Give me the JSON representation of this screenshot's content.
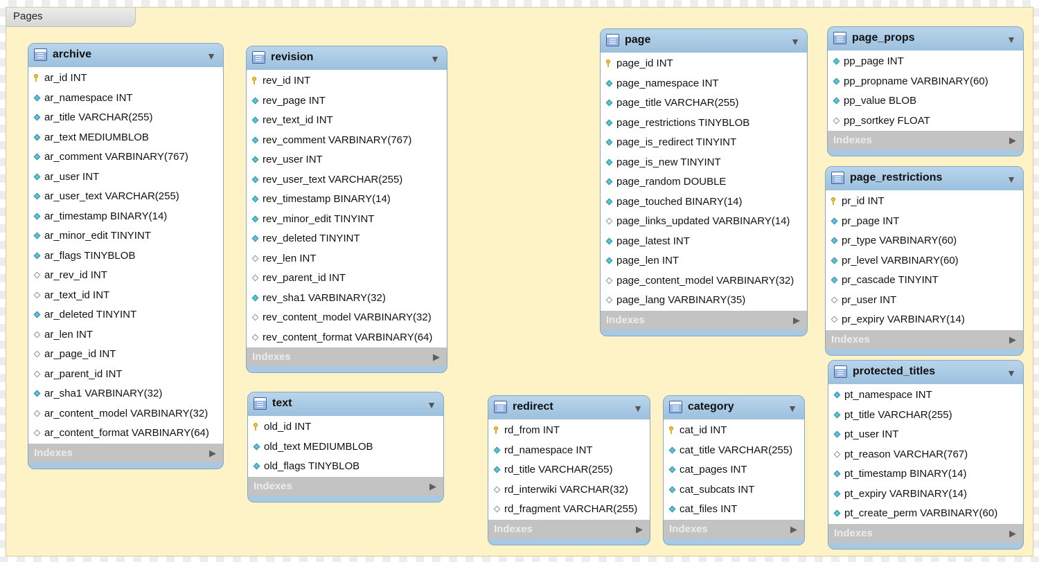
{
  "layer": {
    "title": "Pages"
  },
  "indexes_label": "Indexes",
  "tables": [
    {
      "name": "archive",
      "columns": [
        {
          "text": "ar_id INT",
          "icon": "key"
        },
        {
          "text": "ar_namespace INT",
          "icon": "filled"
        },
        {
          "text": "ar_title VARCHAR(255)",
          "icon": "filled"
        },
        {
          "text": "ar_text MEDIUMBLOB",
          "icon": "filled"
        },
        {
          "text": "ar_comment VARBINARY(767)",
          "icon": "filled"
        },
        {
          "text": "ar_user INT",
          "icon": "filled"
        },
        {
          "text": "ar_user_text VARCHAR(255)",
          "icon": "filled"
        },
        {
          "text": "ar_timestamp BINARY(14)",
          "icon": "filled"
        },
        {
          "text": "ar_minor_edit TINYINT",
          "icon": "filled"
        },
        {
          "text": "ar_flags TINYBLOB",
          "icon": "filled"
        },
        {
          "text": "ar_rev_id INT",
          "icon": "empty"
        },
        {
          "text": "ar_text_id INT",
          "icon": "empty"
        },
        {
          "text": "ar_deleted TINYINT",
          "icon": "filled"
        },
        {
          "text": "ar_len INT",
          "icon": "empty"
        },
        {
          "text": "ar_page_id INT",
          "icon": "empty"
        },
        {
          "text": "ar_parent_id INT",
          "icon": "empty"
        },
        {
          "text": "ar_sha1 VARBINARY(32)",
          "icon": "filled"
        },
        {
          "text": "ar_content_model VARBINARY(32)",
          "icon": "empty"
        },
        {
          "text": "ar_content_format VARBINARY(64)",
          "icon": "empty"
        }
      ]
    },
    {
      "name": "revision",
      "columns": [
        {
          "text": "rev_id INT",
          "icon": "key"
        },
        {
          "text": "rev_page INT",
          "icon": "filled"
        },
        {
          "text": "rev_text_id INT",
          "icon": "filled"
        },
        {
          "text": "rev_comment VARBINARY(767)",
          "icon": "filled"
        },
        {
          "text": "rev_user INT",
          "icon": "filled"
        },
        {
          "text": "rev_user_text VARCHAR(255)",
          "icon": "filled"
        },
        {
          "text": "rev_timestamp BINARY(14)",
          "icon": "filled"
        },
        {
          "text": "rev_minor_edit TINYINT",
          "icon": "filled"
        },
        {
          "text": "rev_deleted TINYINT",
          "icon": "filled"
        },
        {
          "text": "rev_len INT",
          "icon": "empty"
        },
        {
          "text": "rev_parent_id INT",
          "icon": "empty"
        },
        {
          "text": "rev_sha1 VARBINARY(32)",
          "icon": "filled"
        },
        {
          "text": "rev_content_model VARBINARY(32)",
          "icon": "empty"
        },
        {
          "text": "rev_content_format VARBINARY(64)",
          "icon": "empty"
        }
      ]
    },
    {
      "name": "text",
      "columns": [
        {
          "text": "old_id INT",
          "icon": "key"
        },
        {
          "text": "old_text MEDIUMBLOB",
          "icon": "filled"
        },
        {
          "text": "old_flags TINYBLOB",
          "icon": "filled"
        }
      ]
    },
    {
      "name": "page",
      "columns": [
        {
          "text": "page_id INT",
          "icon": "key"
        },
        {
          "text": "page_namespace INT",
          "icon": "filled"
        },
        {
          "text": "page_title VARCHAR(255)",
          "icon": "filled"
        },
        {
          "text": "page_restrictions TINYBLOB",
          "icon": "filled"
        },
        {
          "text": "page_is_redirect TINYINT",
          "icon": "filled"
        },
        {
          "text": "page_is_new TINYINT",
          "icon": "filled"
        },
        {
          "text": "page_random DOUBLE",
          "icon": "filled"
        },
        {
          "text": "page_touched BINARY(14)",
          "icon": "filled"
        },
        {
          "text": "page_links_updated VARBINARY(14)",
          "icon": "empty"
        },
        {
          "text": "page_latest INT",
          "icon": "filled"
        },
        {
          "text": "page_len INT",
          "icon": "filled"
        },
        {
          "text": "page_content_model VARBINARY(32)",
          "icon": "empty"
        },
        {
          "text": "page_lang VARBINARY(35)",
          "icon": "empty"
        }
      ]
    },
    {
      "name": "page_props",
      "columns": [
        {
          "text": "pp_page INT",
          "icon": "filled"
        },
        {
          "text": "pp_propname VARBINARY(60)",
          "icon": "filled"
        },
        {
          "text": "pp_value BLOB",
          "icon": "filled"
        },
        {
          "text": "pp_sortkey FLOAT",
          "icon": "empty"
        }
      ]
    },
    {
      "name": "page_restrictions",
      "columns": [
        {
          "text": "pr_id INT",
          "icon": "key"
        },
        {
          "text": "pr_page INT",
          "icon": "filled"
        },
        {
          "text": "pr_type VARBINARY(60)",
          "icon": "filled"
        },
        {
          "text": "pr_level VARBINARY(60)",
          "icon": "filled"
        },
        {
          "text": "pr_cascade TINYINT",
          "icon": "filled"
        },
        {
          "text": "pr_user INT",
          "icon": "empty"
        },
        {
          "text": "pr_expiry VARBINARY(14)",
          "icon": "empty"
        }
      ]
    },
    {
      "name": "protected_titles",
      "columns": [
        {
          "text": "pt_namespace INT",
          "icon": "filled"
        },
        {
          "text": "pt_title VARCHAR(255)",
          "icon": "filled"
        },
        {
          "text": "pt_user INT",
          "icon": "filled"
        },
        {
          "text": "pt_reason VARCHAR(767)",
          "icon": "empty"
        },
        {
          "text": "pt_timestamp BINARY(14)",
          "icon": "filled"
        },
        {
          "text": "pt_expiry VARBINARY(14)",
          "icon": "filled"
        },
        {
          "text": "pt_create_perm VARBINARY(60)",
          "icon": "filled"
        }
      ]
    },
    {
      "name": "redirect",
      "columns": [
        {
          "text": "rd_from INT",
          "icon": "key"
        },
        {
          "text": "rd_namespace INT",
          "icon": "filled"
        },
        {
          "text": "rd_title VARCHAR(255)",
          "icon": "filled"
        },
        {
          "text": "rd_interwiki VARCHAR(32)",
          "icon": "empty"
        },
        {
          "text": "rd_fragment VARCHAR(255)",
          "icon": "empty"
        }
      ]
    },
    {
      "name": "category",
      "columns": [
        {
          "text": "cat_id INT",
          "icon": "key"
        },
        {
          "text": "cat_title VARCHAR(255)",
          "icon": "filled"
        },
        {
          "text": "cat_pages INT",
          "icon": "filled"
        },
        {
          "text": "cat_subcats INT",
          "icon": "filled"
        },
        {
          "text": "cat_files INT",
          "icon": "filled"
        }
      ]
    }
  ]
}
